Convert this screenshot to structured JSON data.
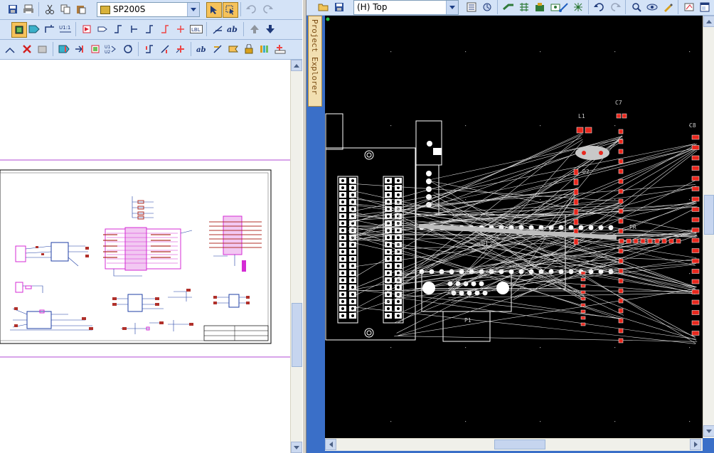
{
  "left_toolbar": {
    "part_selector": "SP200S",
    "row1_icons": [
      "save-icon",
      "print-icon",
      "cut-icon",
      "copy-icon",
      "paste-icon",
      "selection-filter-icon",
      "select-mode-icon",
      "undo-icon",
      "redo-icon"
    ],
    "row2_icons": [
      "component-icon",
      "bus-icon",
      "wire-icon",
      "net-label-icon",
      "power-port-icon",
      "ground-icon",
      "no-connect-icon",
      "text-label-icon",
      "arrow-up-icon",
      "arrow-down-icon"
    ],
    "row3_icons": [
      "delete-icon",
      "annotate-icon",
      "place-part-icon",
      "sheet-symbol-icon",
      "port-icon",
      "directive-icon",
      "parameter-icon",
      "text-frame-icon",
      "library-icon",
      "zoom-fit-icon"
    ]
  },
  "right_toolbar": {
    "layer_selector": "(H) Top",
    "icons": [
      "open-folder-icon",
      "save-icon",
      "properties-icon",
      "route-icon",
      "autoroute-icon",
      "design-rules-icon",
      "via-icon",
      "route-track-icon",
      "fanout-icon",
      "undo-icon",
      "redo-icon",
      "find-icon",
      "view-icon",
      "highlight-icon",
      "layer-icon",
      "window-icon"
    ]
  },
  "project_explorer": {
    "label": "Project Explorer"
  },
  "pcb": {
    "refdes": {
      "l1": "L1",
      "c7": "C7",
      "c8": "C8",
      "d2": "D2",
      "u1": "U1",
      "p1": "P1",
      "pr": "PR"
    },
    "colors": {
      "background": "#000000",
      "outline": "#ffffff",
      "ratsnest": "#d9d9d9",
      "pad_red": "#e8281e",
      "grid_dot": "#9a9a9a"
    }
  },
  "schematic": {
    "colors": {
      "component_pink": "#d42bd4",
      "pin_red": "#b0302a",
      "wire_blue": "#1f3fa5",
      "sheet_border": "#000000",
      "page_rule": "#b04ad6"
    }
  }
}
